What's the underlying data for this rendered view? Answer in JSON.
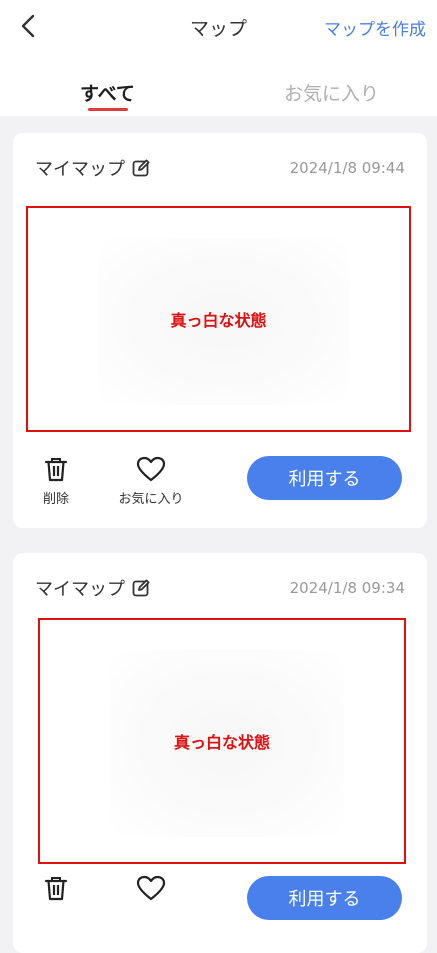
{
  "header": {
    "title": "マップ",
    "create_label": "マップを作成",
    "back_icon": "chevron-left-icon"
  },
  "tabs": [
    {
      "label": "すべて",
      "active": true
    },
    {
      "label": "お気に入り",
      "active": false
    }
  ],
  "colors": {
    "accent": "#4a80ec",
    "tab_indicator": "#e03a3a",
    "annotation_red": "#e01010"
  },
  "cards": [
    {
      "name": "マイマップ",
      "date": "2024/1/8 09:44",
      "preview_note": "真っ白な状態",
      "delete_label": "削除",
      "favorite_label": "お気に入り",
      "use_label": "利用する"
    },
    {
      "name": "マイマップ",
      "date": "2024/1/8 09:34",
      "preview_note": "真っ白な状態",
      "delete_label": "",
      "favorite_label": "",
      "use_label": "利用する"
    }
  ]
}
